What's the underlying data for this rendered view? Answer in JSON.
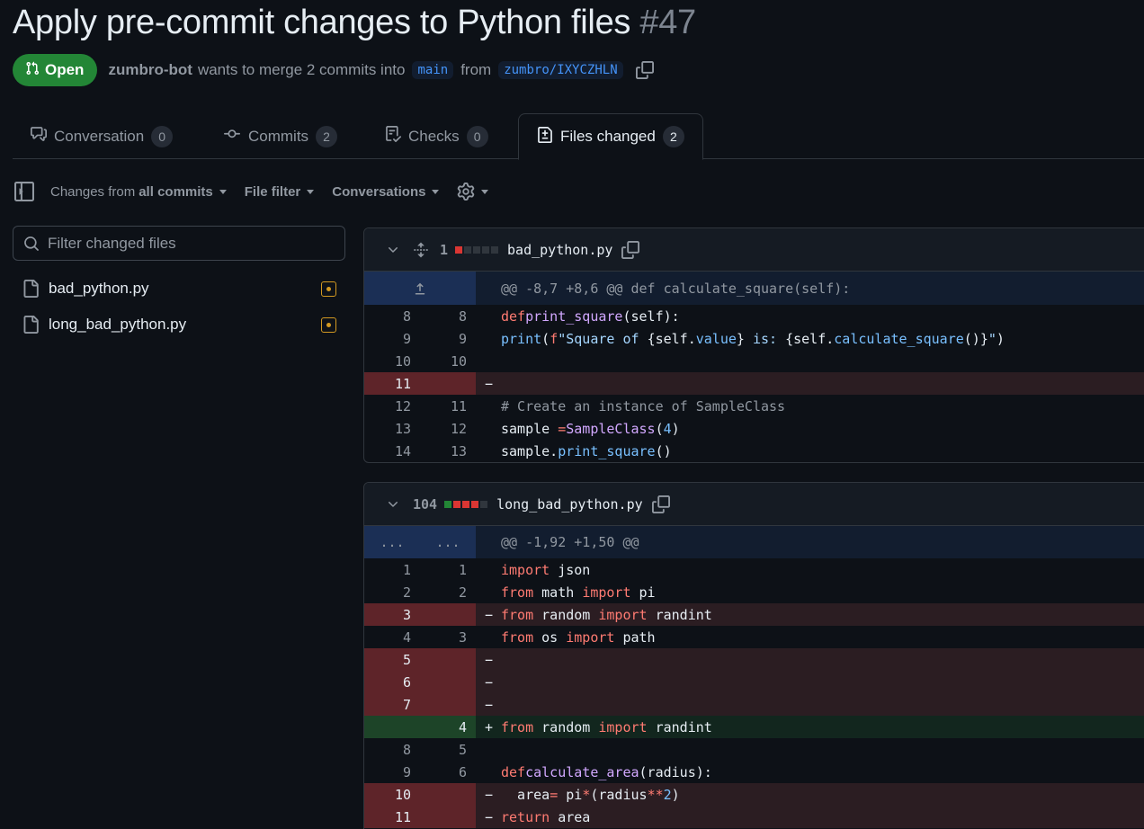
{
  "pr": {
    "title": "Apply pre-commit changes to Python files",
    "number": "#47",
    "state": "Open",
    "author": "zumbro-bot",
    "merge_text": "wants to merge 2 commits into",
    "base_branch": "main",
    "from_text": "from",
    "head_branch": "zumbro/IXYCZHLN"
  },
  "tabs": [
    {
      "label": "Conversation",
      "count": "0",
      "icon": "comment-discussion-icon"
    },
    {
      "label": "Commits",
      "count": "2",
      "icon": "git-commit-icon"
    },
    {
      "label": "Checks",
      "count": "0",
      "icon": "checklist-icon"
    },
    {
      "label": "Files changed",
      "count": "2",
      "icon": "file-diff-icon"
    }
  ],
  "toolbar": {
    "changes_prefix": "Changes from",
    "changes_value": "all commits",
    "file_filter": "File filter",
    "conversations": "Conversations"
  },
  "sidebar": {
    "filter_placeholder": "Filter changed files",
    "files": [
      {
        "name": "bad_python.py"
      },
      {
        "name": "long_bad_python.py"
      }
    ]
  },
  "diffs": [
    {
      "count": "1",
      "filename": "bad_python.py",
      "hunk": "@@ -8,7 +8,6 @@ def calculate_square(self):",
      "lines": [
        {
          "type": "ctx",
          "old": "8",
          "new": "8",
          "text": "    def print_square(self):"
        },
        {
          "type": "ctx",
          "old": "9",
          "new": "9",
          "text": "        print(f\"Square of {self.value} is: {self.calculate_square()}\")"
        },
        {
          "type": "ctx",
          "old": "10",
          "new": "10",
          "text": ""
        },
        {
          "type": "del",
          "old": "11",
          "new": "",
          "text": ""
        },
        {
          "type": "ctx",
          "old": "12",
          "new": "11",
          "text": "# Create an instance of SampleClass"
        },
        {
          "type": "ctx",
          "old": "13",
          "new": "12",
          "text": "sample = SampleClass(4)"
        },
        {
          "type": "ctx",
          "old": "14",
          "new": "13",
          "text": "sample.print_square()"
        }
      ]
    },
    {
      "count": "104",
      "filename": "long_bad_python.py",
      "hunk": "@@ -1,92 +1,50 @@",
      "hunk_old": "...",
      "hunk_new": "...",
      "lines": [
        {
          "type": "ctx",
          "old": "1",
          "new": "1",
          "text": "import json"
        },
        {
          "type": "ctx",
          "old": "2",
          "new": "2",
          "text": "from math import pi"
        },
        {
          "type": "del",
          "old": "3",
          "new": "",
          "text": "from random import randint"
        },
        {
          "type": "ctx",
          "old": "4",
          "new": "3",
          "text": "from os import path"
        },
        {
          "type": "del",
          "old": "5",
          "new": "",
          "text": ""
        },
        {
          "type": "del",
          "old": "6",
          "new": "",
          "text": ""
        },
        {
          "type": "del",
          "old": "7",
          "new": "",
          "text": ""
        },
        {
          "type": "add",
          "old": "",
          "new": "4",
          "text": "from random import randint"
        },
        {
          "type": "ctx",
          "old": "8",
          "new": "5",
          "text": ""
        },
        {
          "type": "ctx",
          "old": "9",
          "new": "6",
          "text": "def calculate_area(radius):"
        },
        {
          "type": "del",
          "old": "10",
          "new": "",
          "text": "  area= pi*(radius**2)"
        },
        {
          "type": "del",
          "old": "11",
          "new": "",
          "text": "  return area"
        }
      ]
    }
  ],
  "colors": {
    "open_green": "#238636",
    "deletion_bg": "#2b1d22",
    "addition_bg": "#12261e",
    "hunk_bg": "#121d2f",
    "link_blue": "#4493f8",
    "modified_orange": "#d29922"
  }
}
